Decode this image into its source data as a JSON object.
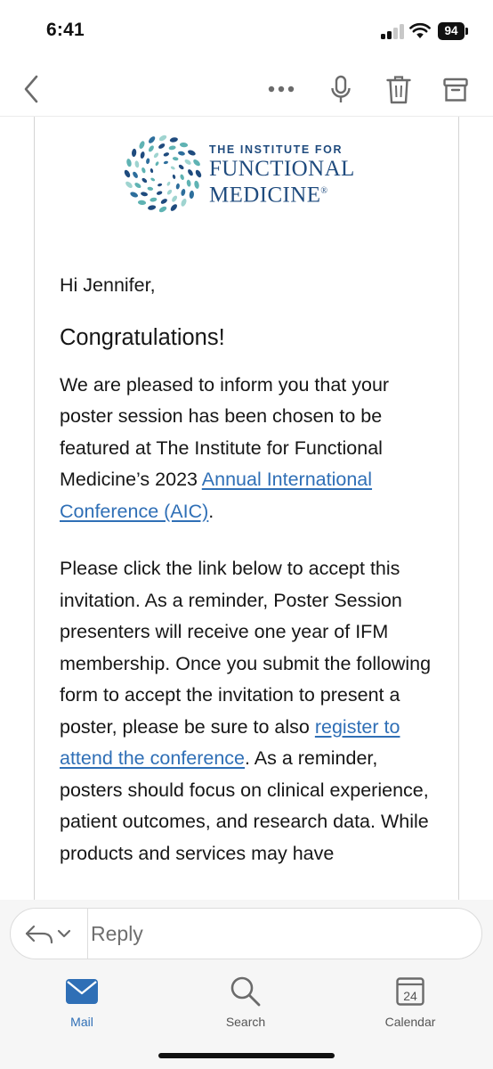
{
  "status_bar": {
    "time": "6:41",
    "battery": "94"
  },
  "toolbar": {
    "back": "back-icon",
    "more": "more-icon",
    "voice": "microphone-icon",
    "delete": "trash-icon",
    "archive": "archive-icon"
  },
  "logo": {
    "line1": "THE INSTITUTE FOR",
    "line2": "FUNCTIONAL",
    "line3": "MEDICINE",
    "reg": "®"
  },
  "email": {
    "greeting": "Hi Jennifer,",
    "headline": "Congratulations!",
    "p1_text": "We are pleased to inform you that your poster session has been chosen to be featured at The Institute for Functional Medicine’s 2023 ",
    "p1_link": "Annual International Conference (AIC)",
    "p1_end": ".",
    "p2_text": "Please click the link below to accept this invitation. As a reminder, Poster Session presenters will receive one year of IFM membership. Once you submit the following form to accept the invitation to present a poster, please be sure to also ",
    "p2_link": "register to attend the conference",
    "p2_end": ". As a reminder, posters should focus on clinical experience, patient outcomes, and research data. While products and services may have"
  },
  "reply": {
    "placeholder": "Reply"
  },
  "tabs": [
    {
      "label": "Mail",
      "icon": "mail-icon",
      "active": true
    },
    {
      "label": "Search",
      "icon": "search-icon",
      "active": false
    },
    {
      "label": "Calendar",
      "icon": "calendar-icon",
      "active": false,
      "badge": "24"
    }
  ],
  "colors": {
    "accent": "#2f6fb6",
    "logo_navy": "#1f4b7e",
    "logo_teal": "#5fb3b3"
  }
}
